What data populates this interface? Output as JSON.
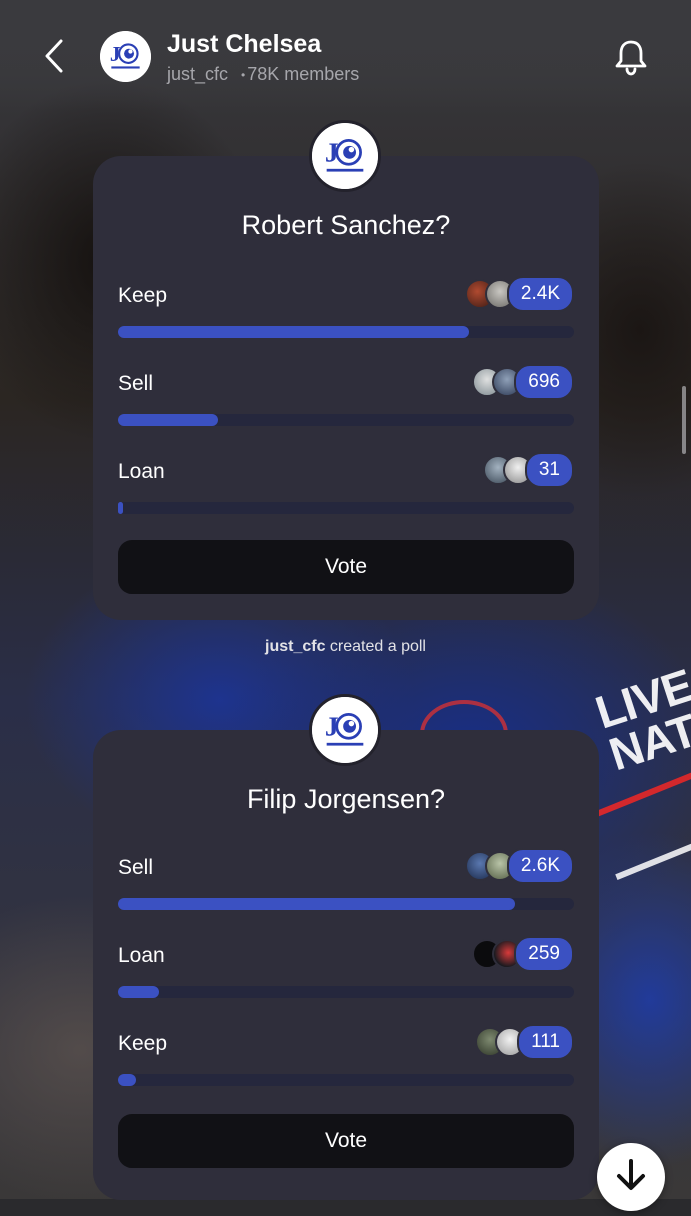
{
  "header": {
    "title": "Just Chelsea",
    "handle": "just_cfc",
    "member_count": "78K members",
    "separator": "•",
    "back_icon": "chevron-left-icon",
    "bell_icon": "bell-icon"
  },
  "logo": {
    "monogram": "JC",
    "text": "JUST CHELSEA"
  },
  "polls": [
    {
      "question": "Robert Sanchez?",
      "options": [
        {
          "label": "Keep",
          "count": "2.4K",
          "fill_fraction": 0.77
        },
        {
          "label": "Sell",
          "count": "696",
          "fill_fraction": 0.22
        },
        {
          "label": "Loan",
          "count": "31",
          "fill_fraction": 0.01
        }
      ],
      "vote_label": "Vote"
    },
    {
      "question": "Filip Jorgensen?",
      "options": [
        {
          "label": "Sell",
          "count": "2.6K",
          "fill_fraction": 0.87
        },
        {
          "label": "Loan",
          "count": "259",
          "fill_fraction": 0.09
        },
        {
          "label": "Keep",
          "count": "111",
          "fill_fraction": 0.04
        }
      ],
      "vote_label": "Vote"
    }
  ],
  "system_note": {
    "user": "just_cfc",
    "action": " created a poll"
  },
  "background_text": "LIVE NATION",
  "colors": {
    "accent": "#3b51c2",
    "card": "#2f2e3b",
    "track": "#25273d",
    "button": "#111115"
  },
  "scroll_down_icon": "arrow-down-icon"
}
